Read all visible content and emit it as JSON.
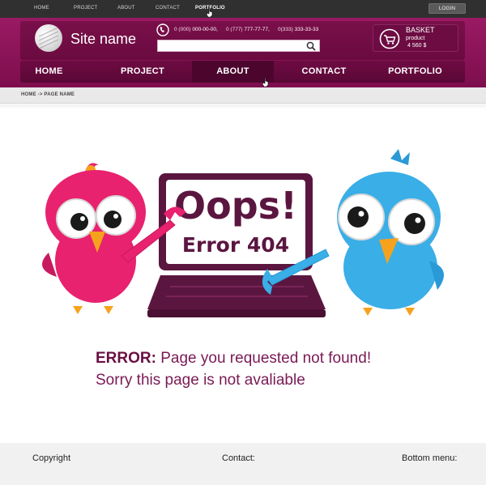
{
  "topbar": {
    "links": [
      "HOME",
      "PROJECT",
      "ABOUT",
      "CONTACT",
      "PORTFOLIO"
    ],
    "active": "PORTFOLIO",
    "login_label": "LOGIN"
  },
  "header": {
    "site_name": "Site name",
    "phones": [
      {
        "prefix": "0 (000) ",
        "number": "000-00-00,"
      },
      {
        "prefix": "0 (777) ",
        "number": "777-77-77,"
      },
      {
        "prefix": "0(333) ",
        "number": "333-33-33"
      }
    ],
    "search": {
      "value": "",
      "placeholder": ""
    },
    "basket": {
      "title": "BASKET",
      "subtitle": "product",
      "price": "4 560 $"
    }
  },
  "nav": {
    "items": [
      "HOME",
      "PROJECT",
      "ABOUT",
      "CONTACT",
      "PORTFOLIO"
    ],
    "active": "ABOUT"
  },
  "breadcrumb": "HOME -> PAGE NAME",
  "error": {
    "headline": "Oops!",
    "code_text": "Error 404",
    "label": "ERROR:",
    "message": " Page you requested not found!",
    "sub_message": "Sorry this page is not avaliable"
  },
  "footer": {
    "copyright": "Copyright",
    "contact": "Contact:",
    "bottom_menu": "Bottom menu:"
  },
  "colors": {
    "brand": "#8a1457",
    "brand_dark": "#5a0836",
    "text_accent": "#7a1a55",
    "pink_bird": "#e8226e",
    "blue_bird": "#3aaee6"
  }
}
